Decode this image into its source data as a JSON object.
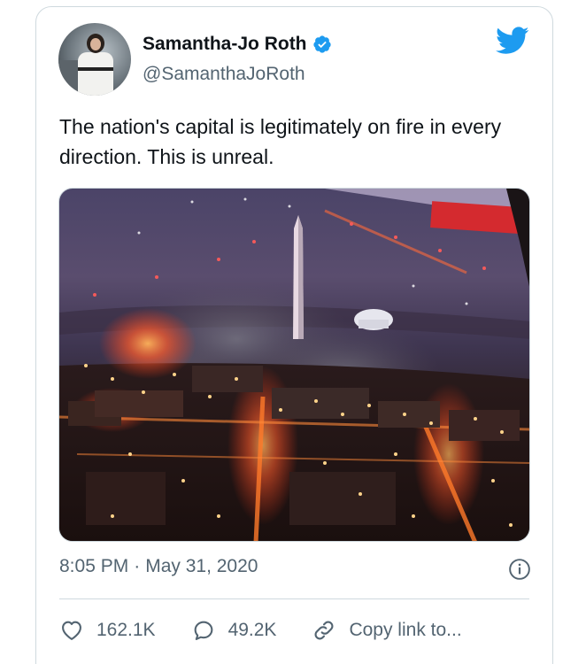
{
  "author": {
    "display_name": "Samantha-Jo Roth",
    "handle": "@SamanthaJoRoth",
    "verified": true
  },
  "tweet": {
    "text": "The nation's capital is legitimately on fire in every direction. This is unreal.",
    "time": "8:05 PM",
    "separator": "·",
    "date": "May 31, 2020"
  },
  "actions": {
    "likes": "162.1K",
    "replies": "49.2K",
    "copy_link": "Copy link to..."
  },
  "icons": {
    "twitter": "twitter-bird-icon",
    "verified": "verified-badge-icon",
    "info": "info-icon",
    "like": "heart-icon",
    "reply": "speech-bubble-icon",
    "link": "link-icon"
  },
  "colors": {
    "brand_blue": "#1d9bf0",
    "text_primary": "#0f1419",
    "text_secondary": "#536471",
    "border": "#cfd9de"
  }
}
